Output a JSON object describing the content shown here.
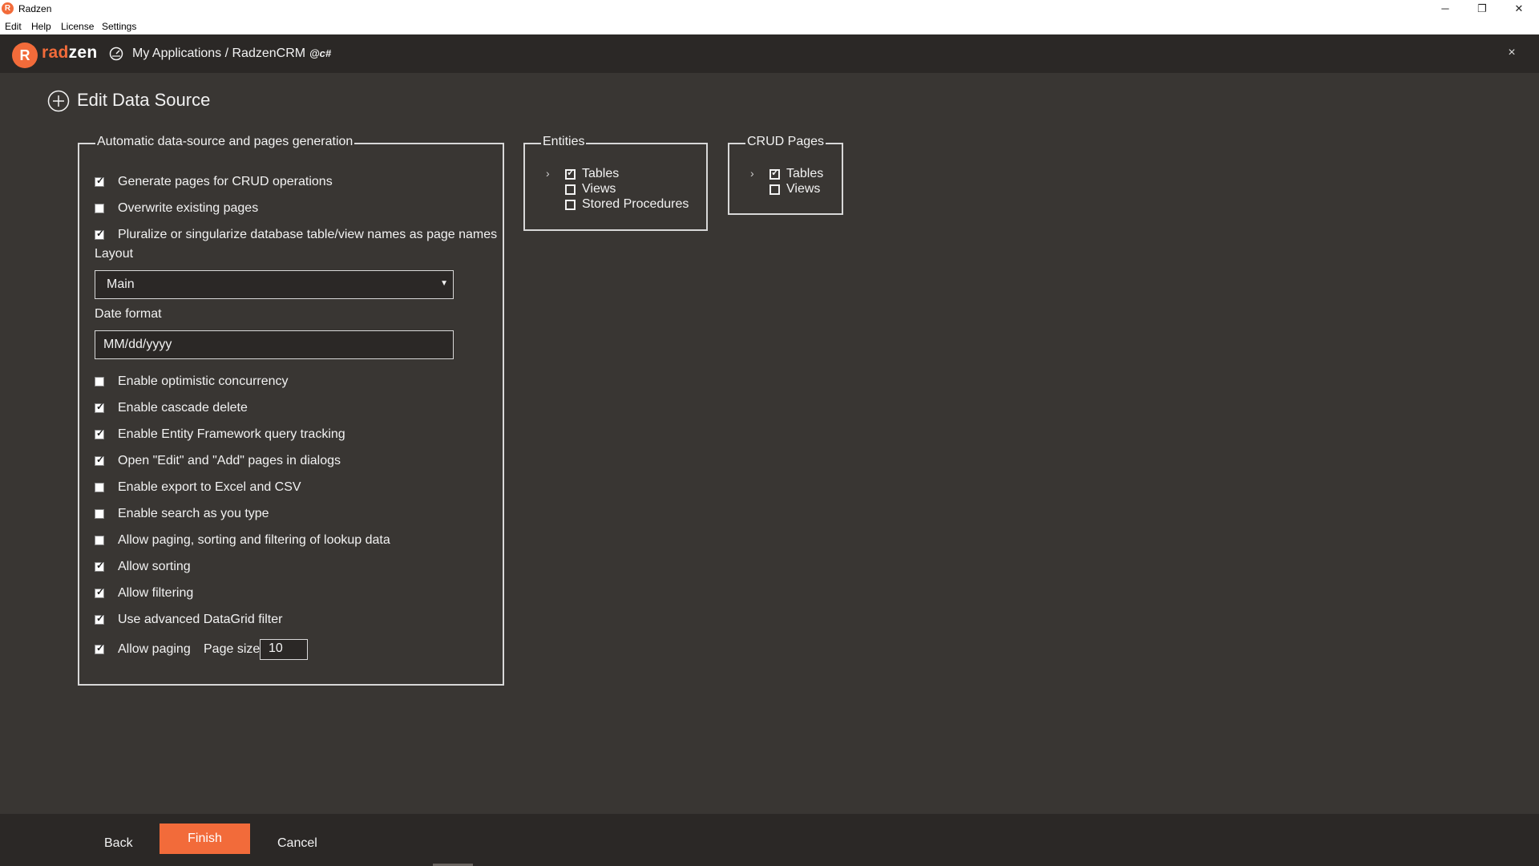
{
  "window": {
    "title": "Radzen",
    "minimize": "─",
    "restore": "❐",
    "close": "✕"
  },
  "menu": [
    "Edit",
    "Help",
    "License",
    "Settings"
  ],
  "header": {
    "logo_mark": "R",
    "logo_text_a": "rad",
    "logo_text_b": "zen",
    "breadcrumb": "My Applications / RadzenCRM",
    "lang_badge": "@c#",
    "close": "×"
  },
  "page": {
    "title": "Edit Data Source"
  },
  "auto_gen": {
    "legend": "Automatic data-source and pages generation",
    "options_top": [
      {
        "label": "Generate pages for CRUD operations",
        "checked": true
      },
      {
        "label": "Overwrite existing pages",
        "checked": false
      },
      {
        "label": "Pluralize or singularize database table/view names as page names",
        "checked": true
      }
    ],
    "layout_label": "Layout",
    "layout_value": "Main",
    "date_format_label": "Date format",
    "date_format_value": "MM/dd/yyyy",
    "options_bottom": [
      {
        "label": "Enable optimistic concurrency",
        "checked": false
      },
      {
        "label": "Enable cascade delete",
        "checked": true
      },
      {
        "label": "Enable Entity Framework query tracking",
        "checked": true
      },
      {
        "label": "Open \"Edit\" and \"Add\" pages in dialogs",
        "checked": true
      },
      {
        "label": "Enable export to Excel and CSV",
        "checked": false
      },
      {
        "label": "Enable search as you type",
        "checked": false
      },
      {
        "label": "Allow paging, sorting and filtering of lookup data",
        "checked": false
      },
      {
        "label": "Allow sorting",
        "checked": true
      },
      {
        "label": "Allow filtering",
        "checked": true
      },
      {
        "label": "Use advanced DataGrid filter",
        "checked": true
      },
      {
        "label": "Allow paging",
        "checked": true
      }
    ],
    "page_size_label": "Page size",
    "page_size_value": "10"
  },
  "entities": {
    "legend": "Entities",
    "items": [
      {
        "label": "Tables",
        "checked": true,
        "expandable": true
      },
      {
        "label": "Views",
        "checked": false,
        "expandable": false
      },
      {
        "label": "Stored Procedures",
        "checked": false,
        "expandable": false
      }
    ]
  },
  "crud_pages": {
    "legend": "CRUD Pages",
    "items": [
      {
        "label": "Tables",
        "checked": true,
        "expandable": true
      },
      {
        "label": "Views",
        "checked": false,
        "expandable": false
      }
    ]
  },
  "footer": {
    "back": "Back",
    "finish": "Finish",
    "cancel": "Cancel"
  },
  "colors": {
    "accent": "#f26b3a",
    "background": "#393633",
    "header": "#2b2826"
  }
}
